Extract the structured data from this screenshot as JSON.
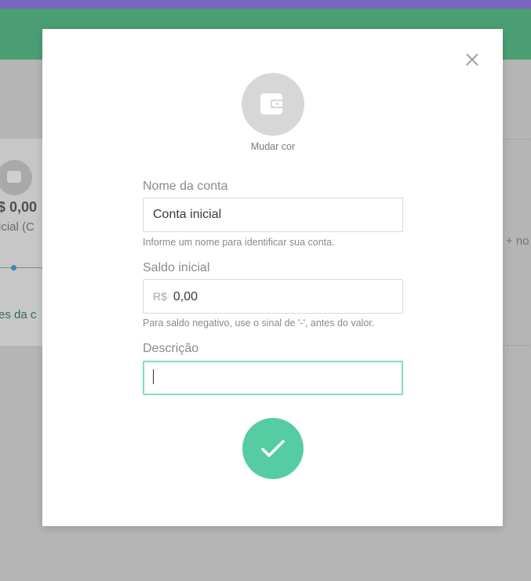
{
  "background": {
    "card_balance": "$ 0,00",
    "card_subtitle": "icial (C",
    "card_link": "es da c",
    "new_account_label": "+ no"
  },
  "modal": {
    "change_color_label": "Mudar cor",
    "fields": {
      "name": {
        "label": "Nome da conta",
        "value": "Conta inicial",
        "hint": "Informe um nome para identificar sua conta."
      },
      "balance": {
        "label": "Saldo inicial",
        "prefix": "R$",
        "value": "0,00",
        "hint": "Para saldo negativo, use o sinal de '-', antes do valor."
      },
      "description": {
        "label": "Descrição",
        "value": ""
      }
    },
    "icons": {
      "close": "close-icon",
      "wallet": "wallet-icon",
      "confirm": "check-icon"
    }
  },
  "colors": {
    "accent": "#56cca2",
    "top_bar": "#7a65bf",
    "focus_border": "#7fe0b3"
  }
}
